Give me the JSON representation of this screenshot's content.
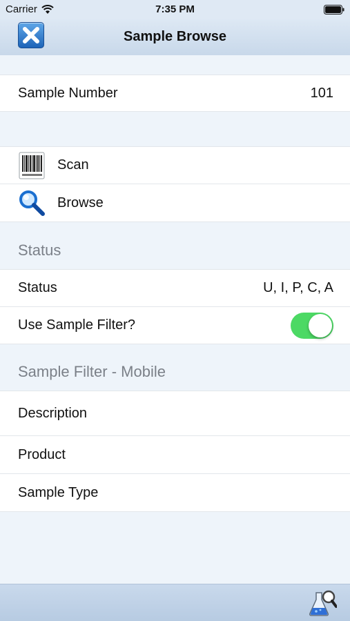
{
  "status_bar": {
    "carrier": "Carrier",
    "time": "7:35 PM",
    "icons": [
      "wifi-icon",
      "battery-icon"
    ]
  },
  "nav": {
    "title": "Sample Browse",
    "close_icon": "close-x-icon"
  },
  "sample_number": {
    "label": "Sample Number",
    "value": "101"
  },
  "actions": [
    {
      "label": "Scan",
      "icon": "barcode-icon"
    },
    {
      "label": "Browse",
      "icon": "magnifier-icon"
    }
  ],
  "status_section": {
    "header": "Status",
    "status_label": "Status",
    "status_value": "U, I, P, C, A",
    "filter_label": "Use Sample Filter?",
    "filter_enabled": true
  },
  "filter_section": {
    "header": "Sample Filter - Mobile",
    "rows": [
      "Description",
      "Product",
      "Sample Type"
    ]
  },
  "toolbar": {
    "icon": "lab-flask-search-icon"
  },
  "colors": {
    "toggle_on": "#4cd964",
    "nav_gradient_top": "#dde8f4",
    "section_header_text": "#7b8088",
    "close_button": "#1e64b8"
  }
}
